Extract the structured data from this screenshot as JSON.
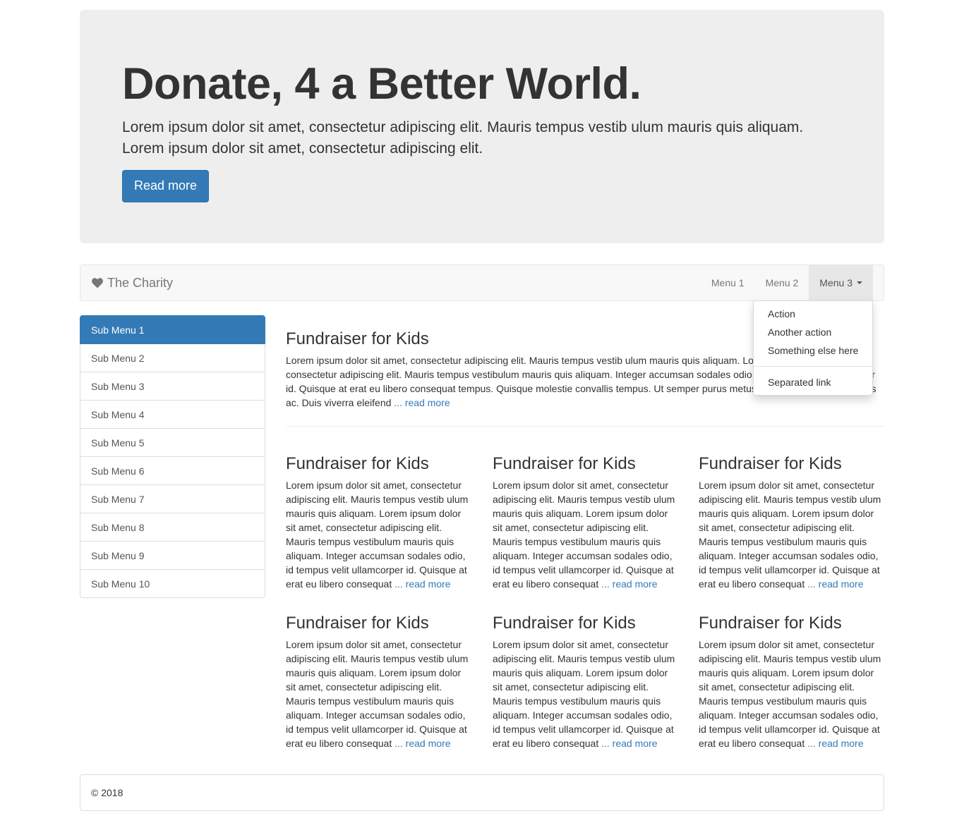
{
  "hero": {
    "title": "Donate, 4 a Better World.",
    "lead": "Lorem ipsum dolor sit amet, consectetur adipiscing elit. Mauris tempus vestib ulum mauris quis aliquam. Lorem ipsum dolor sit amet, consectetur adipiscing elit.",
    "button_label": "Read more"
  },
  "navbar": {
    "brand": "The Charity",
    "brand_icon": "heart-icon",
    "menus": [
      "Menu 1",
      "Menu 2",
      "Menu 3"
    ],
    "dropdown": {
      "items": [
        "Action",
        "Another action",
        "Something else here"
      ],
      "separated": "Separated link"
    }
  },
  "sidebar": {
    "items": [
      "Sub Menu 1",
      "Sub Menu 2",
      "Sub Menu 3",
      "Sub Menu 4",
      "Sub Menu 5",
      "Sub Menu 6",
      "Sub Menu 7",
      "Sub Menu 8",
      "Sub Menu 9",
      "Sub Menu 10"
    ],
    "active_index": 0
  },
  "featured": {
    "title": "Fundraiser for Kids",
    "body": "Lorem ipsum dolor sit amet, consectetur adipiscing elit. Mauris tempus vestib ulum mauris quis aliquam. Lorem ipsum dolor sit amet, consectetur adipiscing elit. Mauris tempus vestibulum mauris quis aliquam. Integer accumsan sodales odio, id tempus velit ullamcorper id. Quisque at erat eu libero consequat tempus. Quisque molestie convallis tempus. Ut semper purus metus, a euismod sapien sodales ac. Duis viverra eleifend",
    "ellipsis": "...",
    "link": "read more"
  },
  "cards": [
    {
      "title": "Fundraiser for Kids",
      "body": "Lorem ipsum dolor sit amet, consectetur adipiscing elit. Mauris tempus vestib ulum mauris quis aliquam. Lorem ipsum dolor sit amet, consectetur adipiscing elit. Mauris tempus vestibulum mauris quis aliquam. Integer accumsan sodales odio, id tempus velit ullamcorper id. Quisque at erat eu libero consequat",
      "ellipsis": "...",
      "link": "read more"
    },
    {
      "title": "Fundraiser for Kids",
      "body": "Lorem ipsum dolor sit amet, consectetur adipiscing elit. Mauris tempus vestib ulum mauris quis aliquam. Lorem ipsum dolor sit amet, consectetur adipiscing elit. Mauris tempus vestibulum mauris quis aliquam. Integer accumsan sodales odio, id tempus velit ullamcorper id. Quisque at erat eu libero consequat",
      "ellipsis": "...",
      "link": "read more"
    },
    {
      "title": "Fundraiser for Kids",
      "body": "Lorem ipsum dolor sit amet, consectetur adipiscing elit. Mauris tempus vestib ulum mauris quis aliquam. Lorem ipsum dolor sit amet, consectetur adipiscing elit. Mauris tempus vestibulum mauris quis aliquam. Integer accumsan sodales odio, id tempus velit ullamcorper id. Quisque at erat eu libero consequat",
      "ellipsis": "...",
      "link": "read more"
    },
    {
      "title": "Fundraiser for Kids",
      "body": "Lorem ipsum dolor sit amet, consectetur adipiscing elit. Mauris tempus vestib ulum mauris quis aliquam. Lorem ipsum dolor sit amet, consectetur adipiscing elit. Mauris tempus vestibulum mauris quis aliquam. Integer accumsan sodales odio, id tempus velit ullamcorper id. Quisque at erat eu libero consequat",
      "ellipsis": "...",
      "link": "read more"
    },
    {
      "title": "Fundraiser for Kids",
      "body": "Lorem ipsum dolor sit amet, consectetur adipiscing elit. Mauris tempus vestib ulum mauris quis aliquam. Lorem ipsum dolor sit amet, consectetur adipiscing elit. Mauris tempus vestibulum mauris quis aliquam. Integer accumsan sodales odio, id tempus velit ullamcorper id. Quisque at erat eu libero consequat",
      "ellipsis": "...",
      "link": "read more"
    },
    {
      "title": "Fundraiser for Kids",
      "body": "Lorem ipsum dolor sit amet, consectetur adipiscing elit. Mauris tempus vestib ulum mauris quis aliquam. Lorem ipsum dolor sit amet, consectetur adipiscing elit. Mauris tempus vestibulum mauris quis aliquam. Integer accumsan sodales odio, id tempus velit ullamcorper id. Quisque at erat eu libero consequat",
      "ellipsis": "...",
      "link": "read more"
    }
  ],
  "footer": {
    "text": "© 2018"
  },
  "colors": {
    "primary": "#337ab7",
    "jumbotron_bg": "#eeeeee",
    "navbar_bg": "#f8f8f8"
  }
}
